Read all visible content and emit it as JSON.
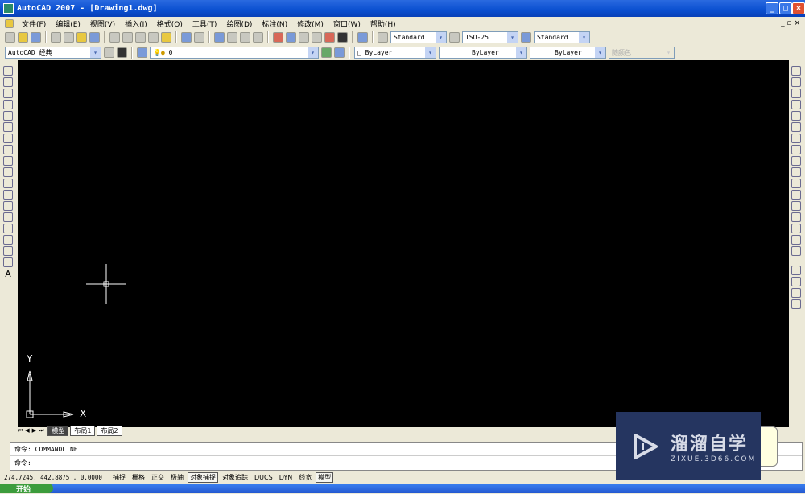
{
  "window": {
    "title": "AutoCAD 2007 - [Drawing1.dwg]"
  },
  "menu": [
    "文件(F)",
    "编辑(E)",
    "视图(V)",
    "插入(I)",
    "格式(O)",
    "工具(T)",
    "绘图(D)",
    "标注(N)",
    "修改(M)",
    "窗口(W)",
    "帮助(H)"
  ],
  "toolbar": {
    "text_style": "Standard",
    "dim_style": "ISO-25",
    "table_style": "Standard",
    "workspace": "AutoCAD 经典",
    "layer": "0",
    "color": "ByLayer",
    "linetype": "ByLayer",
    "lineweight": "ByLayer",
    "plotstyle": "随颜色"
  },
  "canvas": {
    "ucs_x": "X",
    "ucs_y": "Y",
    "background": "#000000"
  },
  "tabs": [
    "模型",
    "布局1",
    "布局2"
  ],
  "command": {
    "history": "命令: COMMANDLINE",
    "prompt": "命令:"
  },
  "status": {
    "coords": "274.7245,  442.8875 , 0.0000",
    "toggles": [
      {
        "label": "捕捉",
        "on": false
      },
      {
        "label": "栅格",
        "on": false
      },
      {
        "label": "正交",
        "on": false
      },
      {
        "label": "极轴",
        "on": false
      },
      {
        "label": "对象捕捉",
        "on": true
      },
      {
        "label": "对象追踪",
        "on": false
      },
      {
        "label": "DUCS",
        "on": false
      },
      {
        "label": "DYN",
        "on": false
      },
      {
        "label": "线宽",
        "on": false
      },
      {
        "label": "模型",
        "on": true
      }
    ]
  },
  "taskbar": {
    "start": "开始"
  },
  "watermark": {
    "title": "溜溜自学",
    "url": "ZIXUE.3D66.COM"
  }
}
